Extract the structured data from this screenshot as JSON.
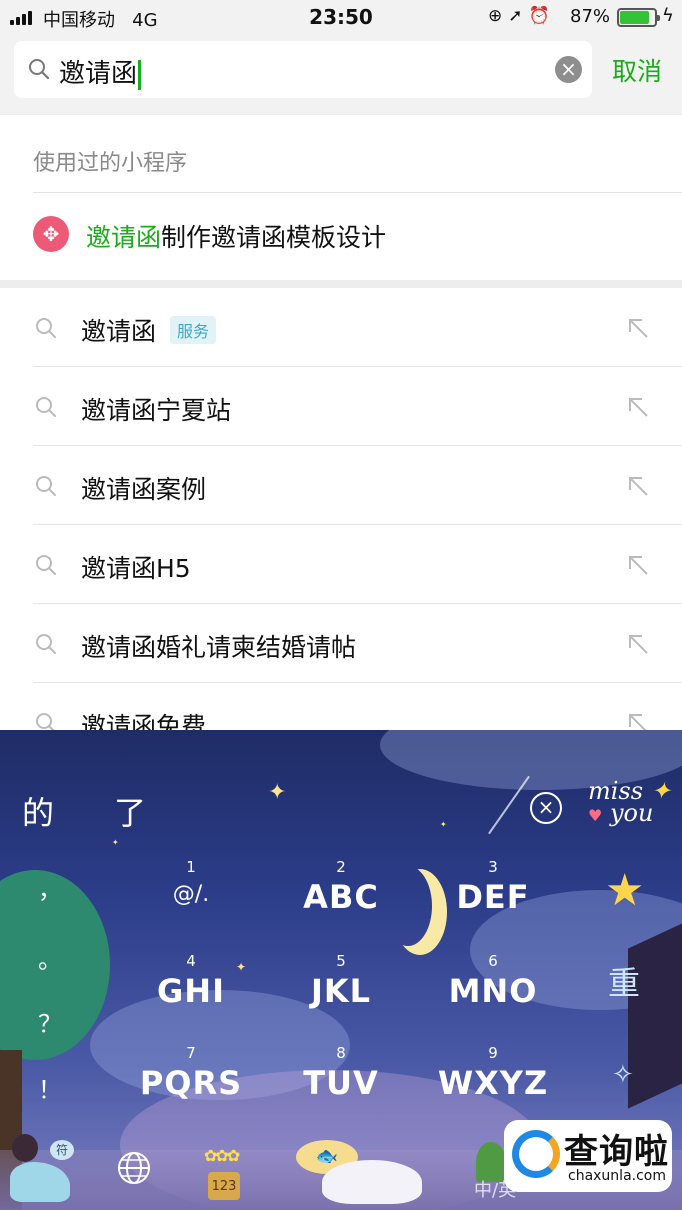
{
  "status_bar": {
    "carrier": "中国移动",
    "network": "4G",
    "time": "23:50",
    "battery_pct": "87%",
    "battery_level": 0.87,
    "battery_color": "#35c335"
  },
  "search": {
    "query": "邀请函",
    "cancel_label": "取消",
    "accent_color": "#1aad19"
  },
  "mini_programs": {
    "section_title": "使用过的小程序",
    "items": [
      {
        "highlight": "邀请函",
        "rest": "制作邀请函模板设计",
        "icon": "knot-logo-icon"
      }
    ]
  },
  "suggestions": [
    {
      "text": "邀请函",
      "tag": "服务"
    },
    {
      "text": "邀请函宁夏站",
      "tag": ""
    },
    {
      "text": "邀请函案例",
      "tag": ""
    },
    {
      "text": "邀请函H5",
      "tag": ""
    },
    {
      "text": "邀请函婚礼请柬结婚请帖",
      "tag": ""
    },
    {
      "text": "邀请函免费",
      "tag": ""
    }
  ],
  "keyboard": {
    "candidates": [
      "的",
      "了"
    ],
    "sticker_text": "miss",
    "sticker_text2": "you",
    "punctuation": [
      "，",
      "。",
      "？",
      "！"
    ],
    "keys": [
      {
        "num": "1",
        "label": "@/."
      },
      {
        "num": "2",
        "label": "ABC"
      },
      {
        "num": "3",
        "label": "DEF"
      },
      {
        "num": "4",
        "label": "GHI"
      },
      {
        "num": "5",
        "label": "JKL"
      },
      {
        "num": "6",
        "label": "MNO"
      },
      {
        "num": "7",
        "label": "PQRS"
      },
      {
        "num": "8",
        "label": "TUV"
      },
      {
        "num": "9",
        "label": "WXYZ"
      }
    ],
    "right_key": "重",
    "bottom_bar": {
      "girl_speech": "符",
      "jar_label": "123",
      "lang_switch": "中/英"
    }
  },
  "watermark": {
    "brand": "查询啦",
    "site": "chaxunla.com"
  }
}
